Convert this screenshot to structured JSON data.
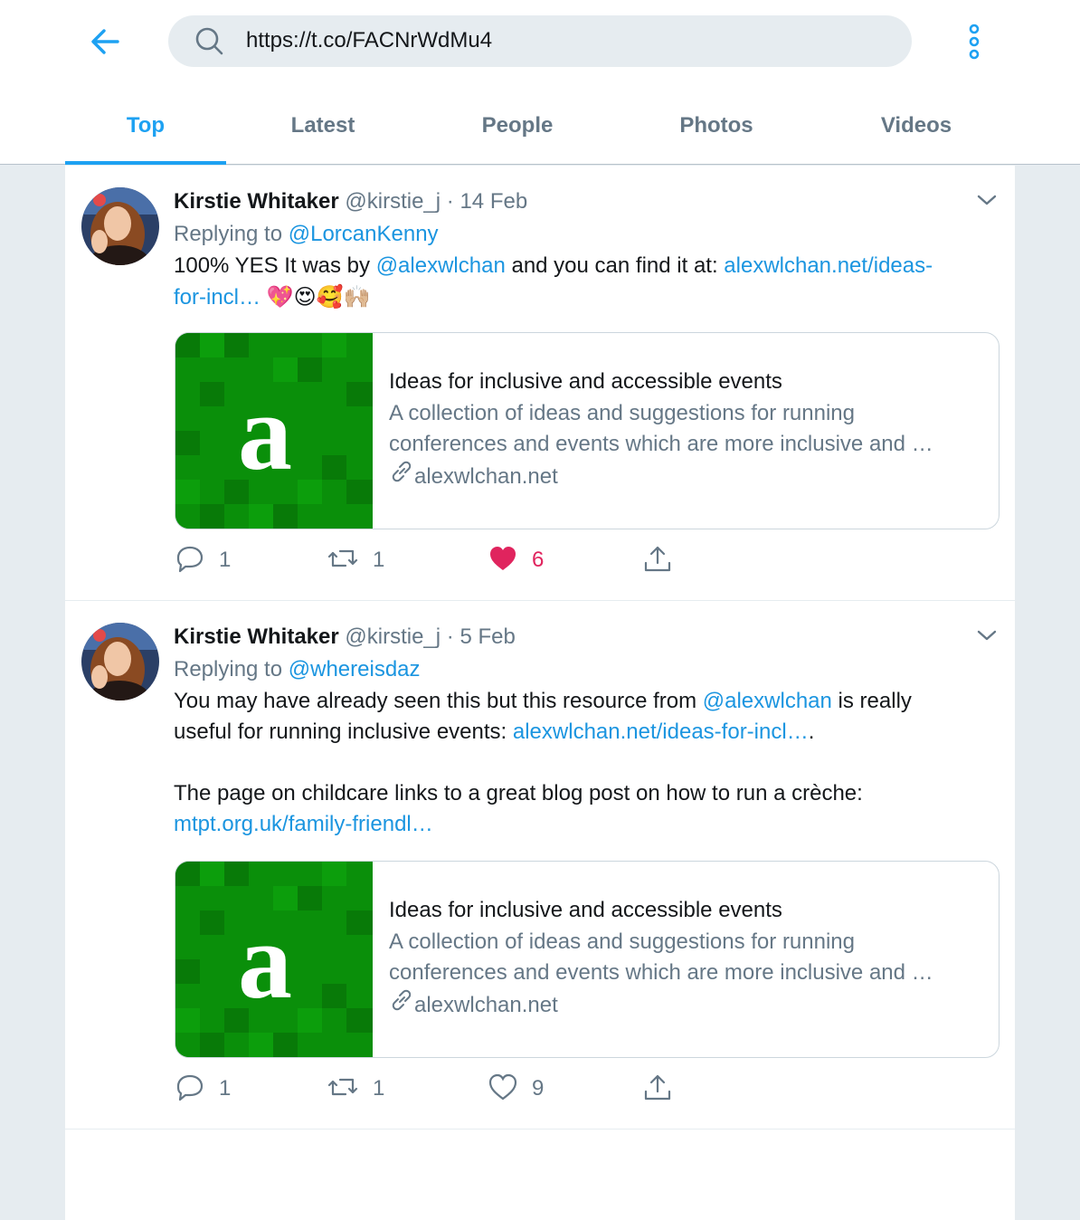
{
  "search": {
    "query": "https://t.co/FACNrWdMu4"
  },
  "icons": {
    "back": "arrow-left-icon",
    "search": "search-icon",
    "more": "more-vertical-icon"
  },
  "tabs": [
    {
      "label": "Top",
      "active": true
    },
    {
      "label": "Latest",
      "active": false
    },
    {
      "label": "People",
      "active": false
    },
    {
      "label": "Photos",
      "active": false
    },
    {
      "label": "Videos",
      "active": false
    }
  ],
  "colors": {
    "accent": "#1da1f2",
    "link": "#1b95e0",
    "like": "#e0245e",
    "muted": "#657786",
    "card_thumb": "#0a8f0a"
  },
  "tweets": [
    {
      "name": "Kirstie Whitaker",
      "handle": "@kirstie_j",
      "separator": "·",
      "date": "14 Feb",
      "replying_prefix": "Replying to",
      "replying_to": "@LorcanKenny",
      "text_1": "100% YES It was by",
      "mention": "@alexwlchan",
      "text_2": "and you can find it at:",
      "link_line1": "alexwlchan.net/ideas-",
      "link_line2": "for-incl…",
      "emojis": "💖😍🥰🙌🏼",
      "card": {
        "logo_letter": "a",
        "title": "Ideas for inclusive and accessible events",
        "desc_line1": "A collection of ideas and suggestions for running",
        "desc_line2": "conferences and events which are more inclusive and …",
        "site": "alexwlchan.net"
      },
      "replies": "1",
      "retweets": "1",
      "likes": "6",
      "liked": true
    },
    {
      "name": "Kirstie Whitaker",
      "handle": "@kirstie_j",
      "separator": "·",
      "date": "5 Feb",
      "replying_prefix": "Replying to",
      "replying_to": "@whereisdaz",
      "text_1": "You may have already seen this but this resource from",
      "mention": "@alexwlchan",
      "text_2": "is really",
      "text_3": "useful for running inclusive events:",
      "link_1": "alexwlchan.net/ideas-for-incl…",
      "text_4": ".",
      "text_5": "The page on childcare links to a great blog post on how to run a crèche:",
      "link_2": "mtpt.org.uk/family-friendl…",
      "card": {
        "logo_letter": "a",
        "title": "Ideas for inclusive and accessible events",
        "desc_line1": "A collection of ideas and suggestions for running",
        "desc_line2": "conferences and events which are more inclusive and …",
        "site": "alexwlchan.net"
      },
      "replies": "1",
      "retweets": "1",
      "likes": "9",
      "liked": false
    }
  ]
}
